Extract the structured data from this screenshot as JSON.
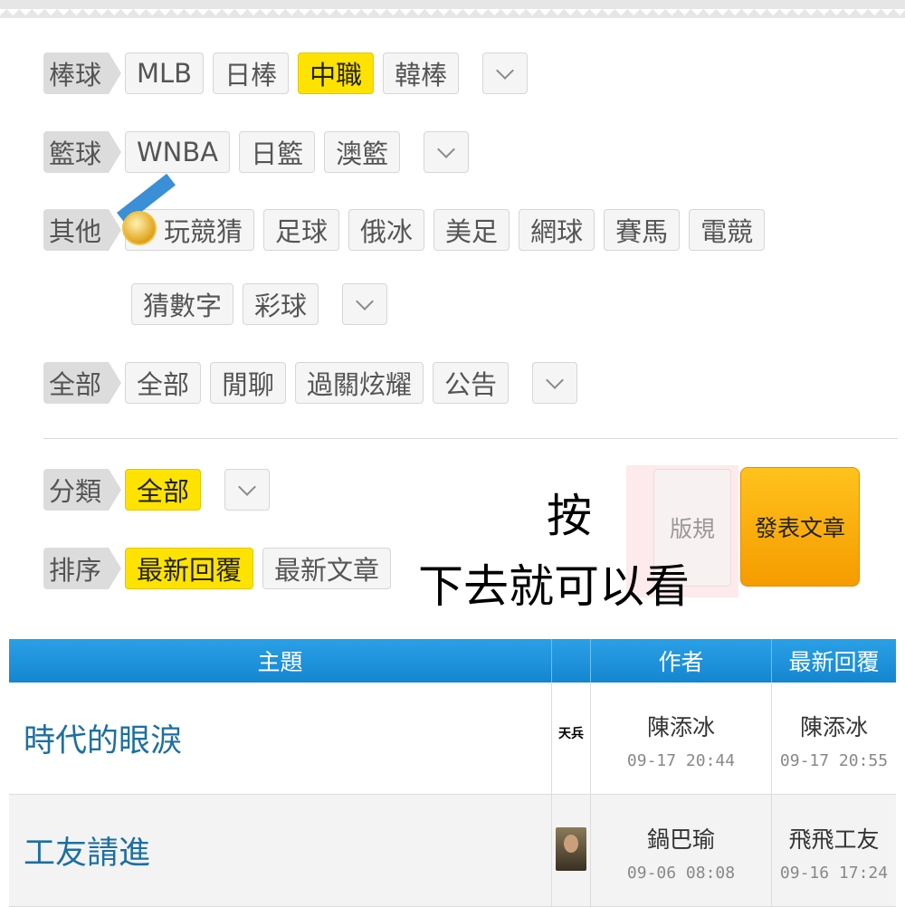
{
  "filters": {
    "baseball": {
      "label": "棒球",
      "items": [
        "MLB",
        "日棒",
        "中職",
        "韓棒"
      ],
      "active": 2
    },
    "basketball": {
      "label": "籃球",
      "items": [
        "WNBA",
        "日籃",
        "澳籃"
      ]
    },
    "other": {
      "label": "其他",
      "items_row1": [
        "玩競猜",
        "足球",
        "俄冰",
        "美足",
        "網球",
        "賽馬",
        "電競"
      ],
      "items_row2": [
        "猜數字",
        "彩球"
      ]
    },
    "all": {
      "label": "全部",
      "items": [
        "全部",
        "閒聊",
        "過關炫耀",
        "公告"
      ]
    }
  },
  "category": {
    "label": "分類",
    "value": "全部"
  },
  "sort": {
    "label": "排序",
    "options": [
      "最新回覆",
      "最新文章"
    ],
    "active": 0
  },
  "overlay_text": {
    "line1": "按",
    "line2": "下去就可以看"
  },
  "buttons": {
    "rules": "版規",
    "post": "發表文章"
  },
  "table": {
    "headers": [
      "主題",
      "作者",
      "最新回覆"
    ],
    "rows": [
      {
        "topic": "時代的眼淚",
        "avatar_text": "天兵",
        "author": "陳添冰",
        "author_time": "09-17 20:44",
        "reply_by": "陳添冰",
        "reply_time": "09-17 20:55"
      },
      {
        "topic": "工友請進",
        "avatar_text": "",
        "author": "鍋巴瑜",
        "author_time": "09-06 08:08",
        "reply_by": "飛飛工友",
        "reply_time": "09-16 17:24"
      }
    ]
  },
  "colors": {
    "active_chip": "#ffe300",
    "post_button": "#f7a800",
    "table_header": "#1e93dc",
    "topic_link": "#1d6fa0"
  },
  "icons": [
    "chevron-down-icon",
    "medal-icon"
  ]
}
